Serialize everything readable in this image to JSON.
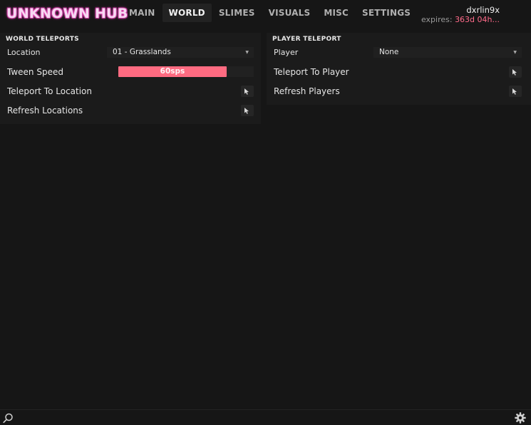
{
  "header": {
    "logo": "UNKNOWN HUB",
    "tabs": [
      {
        "label": "MAIN",
        "active": false
      },
      {
        "label": "WORLD",
        "active": true
      },
      {
        "label": "SLIMES",
        "active": false
      },
      {
        "label": "VISUALS",
        "active": false
      },
      {
        "label": "MISC",
        "active": false
      },
      {
        "label": "SETTINGS",
        "active": false
      }
    ],
    "user": {
      "name": "dxrlin9x",
      "expires_label": "expires:",
      "expires_value": "363d 04h..."
    }
  },
  "world_teleports": {
    "title": "WORLD TELEPORTS",
    "location_label": "Location",
    "location_value": "01 - Grasslands",
    "tween_label": "Tween Speed",
    "tween_value_text": "60sps",
    "tween_fill_fraction": 0.8,
    "teleport_label": "Teleport To Location",
    "refresh_label": "Refresh Locations"
  },
  "player_teleport": {
    "title": "PLAYER TELEPORT",
    "player_label": "Player",
    "player_value": "None",
    "teleport_label": "Teleport To Player",
    "refresh_label": "Refresh Players"
  },
  "colors": {
    "accent": "#ff6b81",
    "background": "#161616",
    "panel": "#1b1b1b"
  },
  "icons": {
    "action_button": "cursor-icon",
    "dropdown": "chevron-down-icon",
    "footer_left": "search-icon",
    "footer_right": "gear-icon"
  }
}
